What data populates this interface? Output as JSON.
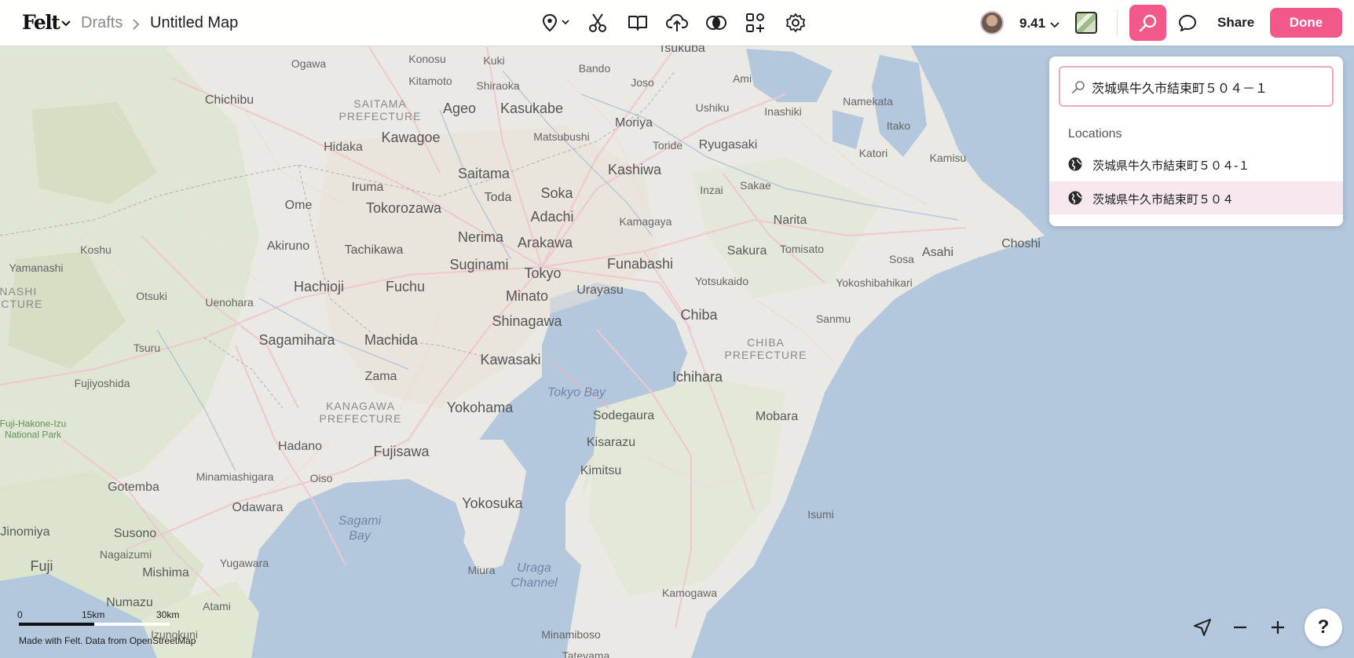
{
  "header": {
    "logo": "Felt",
    "breadcrumb_parent": "Drafts",
    "map_title": "Untitled Map",
    "zoom_level": "9.41",
    "share_label": "Share",
    "done_label": "Done"
  },
  "toolbar": {
    "tools": [
      "pin-icon",
      "scissors-icon",
      "book-icon",
      "upload-cloud-icon",
      "layers-overlap-icon",
      "elements-icon",
      "settings-icon"
    ]
  },
  "search": {
    "query": "茨城県牛久市結束町５０４－１",
    "section_heading": "Locations",
    "results": [
      {
        "label": "茨城県牛久市結束町５０４‐１",
        "highlighted": false
      },
      {
        "label": "茨城県牛久市結束町５０４",
        "highlighted": true
      }
    ]
  },
  "map": {
    "labels_large": [
      "Kawagoe",
      "Saitama",
      "Tokorozawa",
      "Nerima",
      "Suginami",
      "Tokyo",
      "Minato",
      "Shinagawa",
      "Kawasaki",
      "Yokohama",
      "Hachioji",
      "Fuchu",
      "Machida",
      "Sagamihara",
      "Fujisawa",
      "Yokosuka",
      "Chiba",
      "Funabashi",
      "Kashiwa",
      "Arakawa",
      "Adachi",
      "Soka",
      "Ageo",
      "Kasukabe",
      "Ichihara"
    ],
    "labels_medium": [
      "Ogawa",
      "Konosu",
      "Kuki",
      "Bando",
      "Tsukuba",
      "Kitamoto",
      "Shiraoka",
      "Joso",
      "Ami",
      "Ushiku",
      "Inashiki",
      "Namekata",
      "Chichibu",
      "Hidaka",
      "Matsubushi",
      "Moriya",
      "Toride",
      "Ryugasaki",
      "Itako",
      "Katori",
      "Kamisu",
      "Iruma",
      "Toda",
      "Inzai",
      "Sakae",
      "Ome",
      "Kamagaya",
      "Narita",
      "Koshu",
      "Akiruno",
      "Tachikawa",
      "Sakura",
      "Tomisato",
      "Asahi",
      "Sosa",
      "Choshi",
      "Yamanashi",
      "Urayasu",
      "Yotsukaido",
      "Yokoshibahikari",
      "Otsuki",
      "Uenohara",
      "Sanmu",
      "Tsuru",
      "Zama",
      "Fujiyoshida",
      "Sodegaura",
      "Mobara",
      "Hadano",
      "Kisarazu",
      "Minamiashigara",
      "Oiso",
      "Kimitsu",
      "Gotemba",
      "Odawara",
      "Isumi",
      "Susono",
      "Nagaizumi",
      "Yugawara",
      "Fuji",
      "Mishima",
      "Miura",
      "Kamogawa",
      "Numazu",
      "Atami",
      "Izunokuni",
      "Minamiboso",
      "Tateyama",
      "Jinomiya"
    ],
    "prefectures": [
      "SAITAMA PREFECTURE",
      "KANAGAWA PREFECTURE",
      "CHIBA PREFECTURE",
      "YAMANASHI PREFECTURE"
    ],
    "water": [
      "Tokyo Bay",
      "Sagami Bay",
      "Uraga Channel"
    ],
    "parks": [
      "Fuji-Hakone-Izu National Park"
    ]
  },
  "footer": {
    "scale_ticks": [
      "0",
      "15km",
      "30km"
    ],
    "attribution": "Made with Felt. Data from OpenStreetMap",
    "help_label": "?"
  }
}
